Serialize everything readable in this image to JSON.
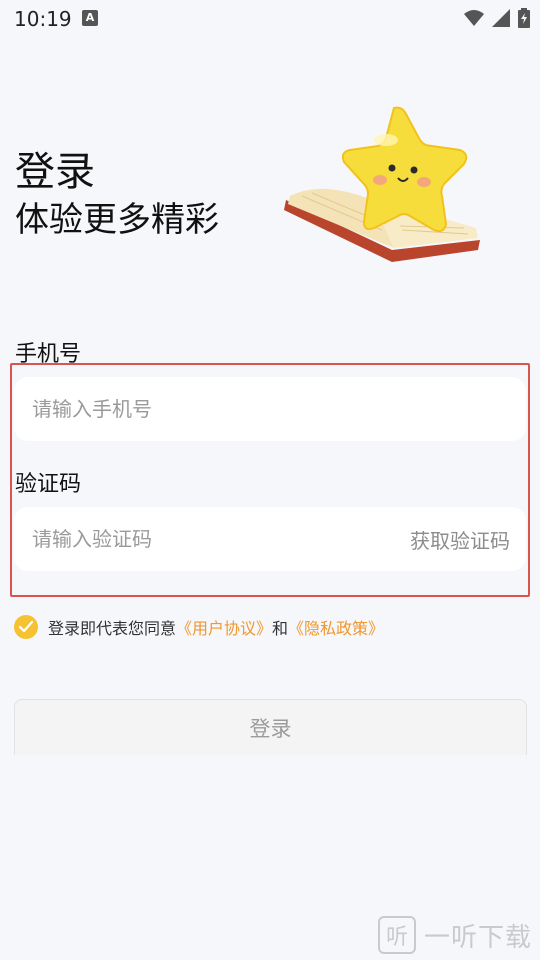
{
  "status_bar": {
    "time": "10:19",
    "notification_glyph": "A"
  },
  "header": {
    "title": "登录",
    "subtitle": "体验更多精彩"
  },
  "illustration": "star-on-book",
  "form": {
    "phone_label": "手机号",
    "phone_placeholder": "请输入手机号",
    "code_label": "验证码",
    "code_placeholder": "请输入验证码",
    "get_code_label": "获取验证码"
  },
  "agreement": {
    "checked": true,
    "prefix": "登录即代表您同意",
    "user_agreement": "《用户协议》",
    "conjunction": "和",
    "privacy_policy": "《隐私政策》"
  },
  "login_button": "登录",
  "watermark": {
    "logo_char": "听",
    "text": "一听下载"
  },
  "colors": {
    "background": "#f6f7fb",
    "accent_yellow": "#f6c231",
    "link_orange": "#f0972d",
    "highlight_red": "#d9534f"
  }
}
